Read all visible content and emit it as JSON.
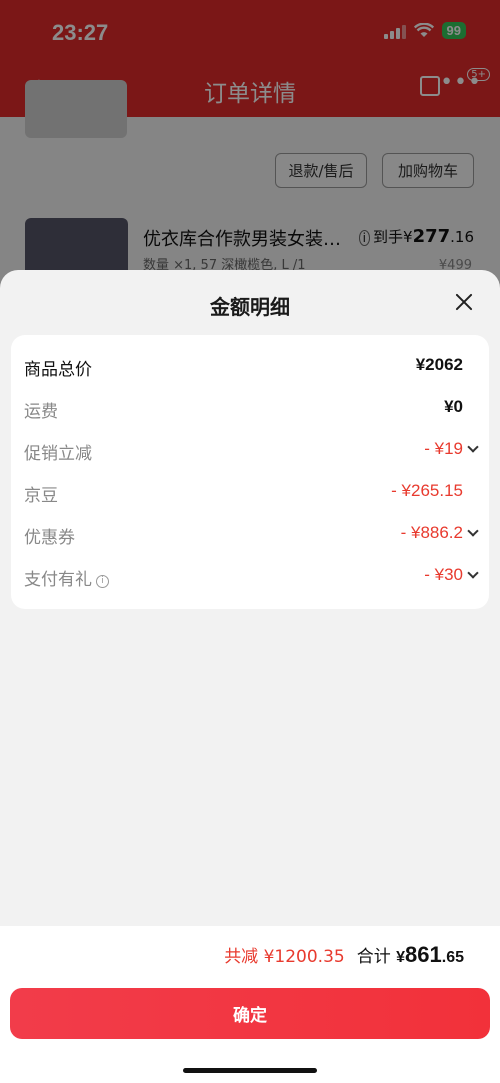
{
  "status_bar": {
    "time": "23:27",
    "battery": "99"
  },
  "nav": {
    "title": "订单详情",
    "badge": "5+"
  },
  "background": {
    "refund_button": "退款/售后",
    "cart_button": "加购物车",
    "item_title": "优衣库合作款男装女装…",
    "item_spec": "数量 ×1, 57 深橄榄色, L /1",
    "item_price_prefix": "到手¥",
    "item_price_int": "277",
    "item_price_dec": ".16",
    "item_original_price": "¥499"
  },
  "sheet": {
    "title": "金额明细",
    "rows": [
      {
        "label": "商品总价",
        "value": "¥2062"
      },
      {
        "label": "运费",
        "value": "¥0"
      },
      {
        "label": "促销立减",
        "value": "- ¥19"
      },
      {
        "label": "京豆",
        "value": "- ¥265.15"
      },
      {
        "label": "优惠券",
        "value": "- ¥886.2"
      },
      {
        "label": "支付有礼",
        "value": "- ¥30"
      }
    ]
  },
  "footer": {
    "total_reduce": "共减 ¥1200.35",
    "total_label": "合计",
    "total_currency": "¥",
    "total_int": "861",
    "total_dec": ".65",
    "confirm_label": "确定"
  },
  "colors": {
    "accent_red": "#e83a2e",
    "button_red": "#f23c4a",
    "header_red": "#e12b2b"
  }
}
